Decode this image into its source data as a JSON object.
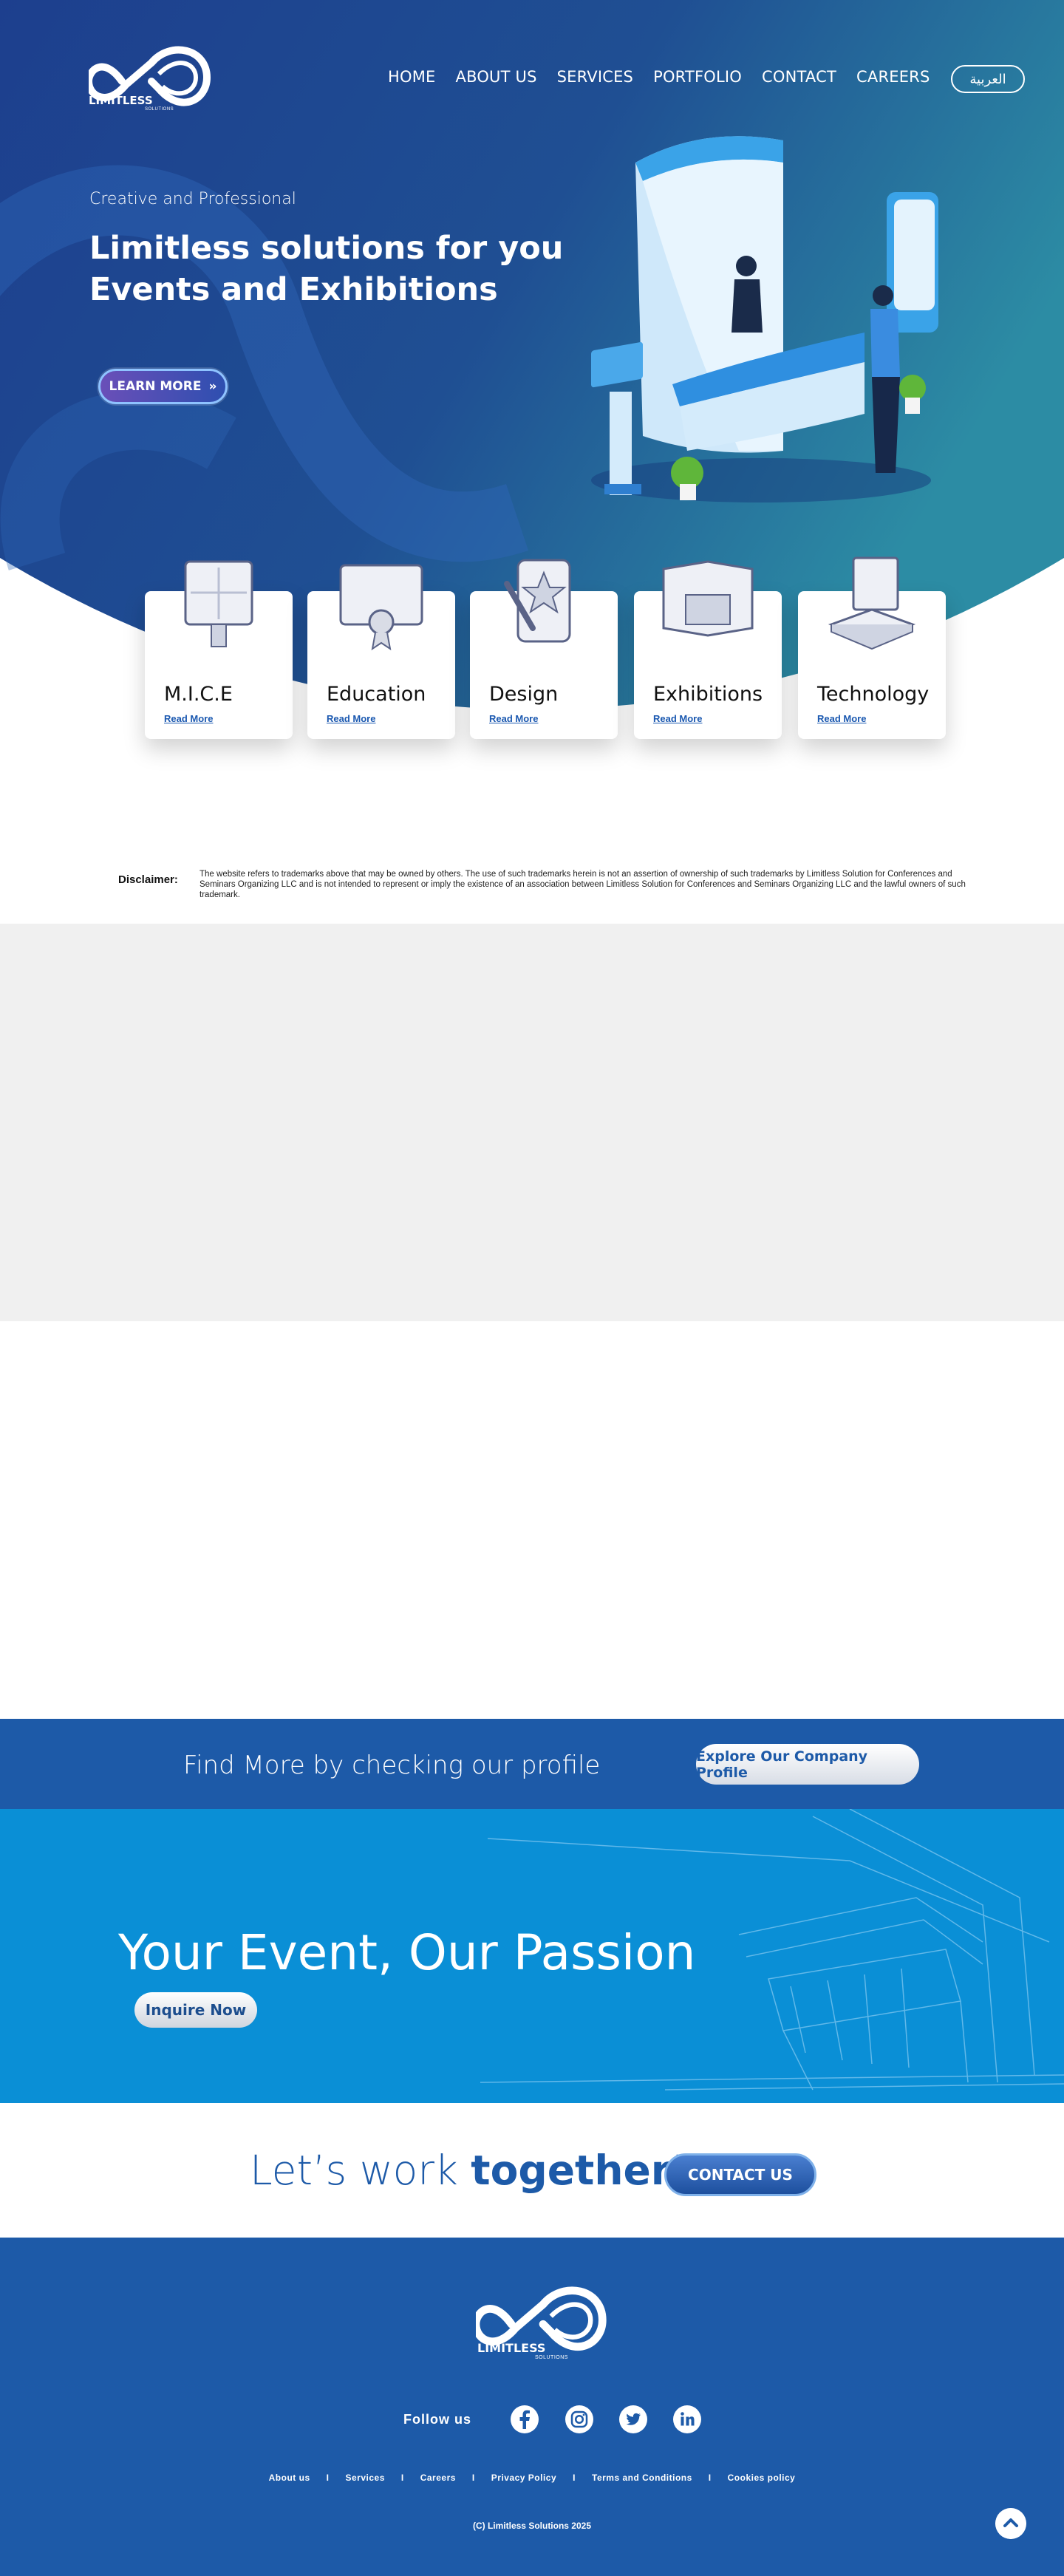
{
  "brand": {
    "logo_text": "LIMITLESS",
    "logo_sub": "SOLUTIONS"
  },
  "nav": {
    "items": [
      "HOME",
      "ABOUT US",
      "SERVICES",
      "PORTFOLIO",
      "CONTACT",
      "CAREERS"
    ],
    "lang_button": "العربية"
  },
  "hero": {
    "subtitle": "Creative and Professional",
    "title_line1": "Limitless solutions for you",
    "title_line2": "Events and Exhibitions",
    "cta": "LEARN MORE"
  },
  "services": [
    {
      "title": "M.I.C.E",
      "link": "Read More",
      "icon": "presentation-board-icon"
    },
    {
      "title": "Education",
      "link": "Read More",
      "icon": "certificate-icon"
    },
    {
      "title": "Design",
      "link": "Read More",
      "icon": "design-tablet-icon"
    },
    {
      "title": "Exhibitions",
      "link": "Read More",
      "icon": "exhibition-booth-icon"
    },
    {
      "title": "Technology",
      "link": "Read More",
      "icon": "computer-icon"
    }
  ],
  "disclaimer": {
    "label": "Disclaimer:",
    "text": "The website refers to trademarks above that may be owned by others. The use of such trademarks herein is not an assertion of ownership of such trademarks by Limitless Solution for Conferences and Seminars Organizing LLC and is not intended to represent or imply the existence of an association between Limitless Solution for Conferences and Seminars Organizing LLC and the lawful owners of such trademark."
  },
  "profile": {
    "text": "Find More by checking our profile",
    "button": "Explore Our Company Profile"
  },
  "passion": {
    "title": "Your Event, Our Passion",
    "button": "Inquire Now"
  },
  "together": {
    "text_light": "Let’s work ",
    "text_bold": "together!",
    "button": "CONTACT US"
  },
  "footer": {
    "logo_text": "LIMITLESS",
    "logo_sub": "SOLUTIONS",
    "follow": "Follow us",
    "social": [
      "facebook-icon",
      "instagram-icon",
      "twitter-icon",
      "linkedin-icon"
    ],
    "links": [
      "About us",
      "Services",
      "Careers",
      "Privacy Policy",
      "Terms and Conditions",
      "Cookies policy"
    ],
    "separator": "I",
    "copyright": "(C) Limitless Solutions 2025"
  },
  "colors": {
    "primary": "#1d5aa8",
    "hero_dark": "#1c3f8c",
    "hero_teal": "#2a8aa6",
    "passion": "#0a8fd6",
    "grey_band": "#f0f0f0"
  }
}
